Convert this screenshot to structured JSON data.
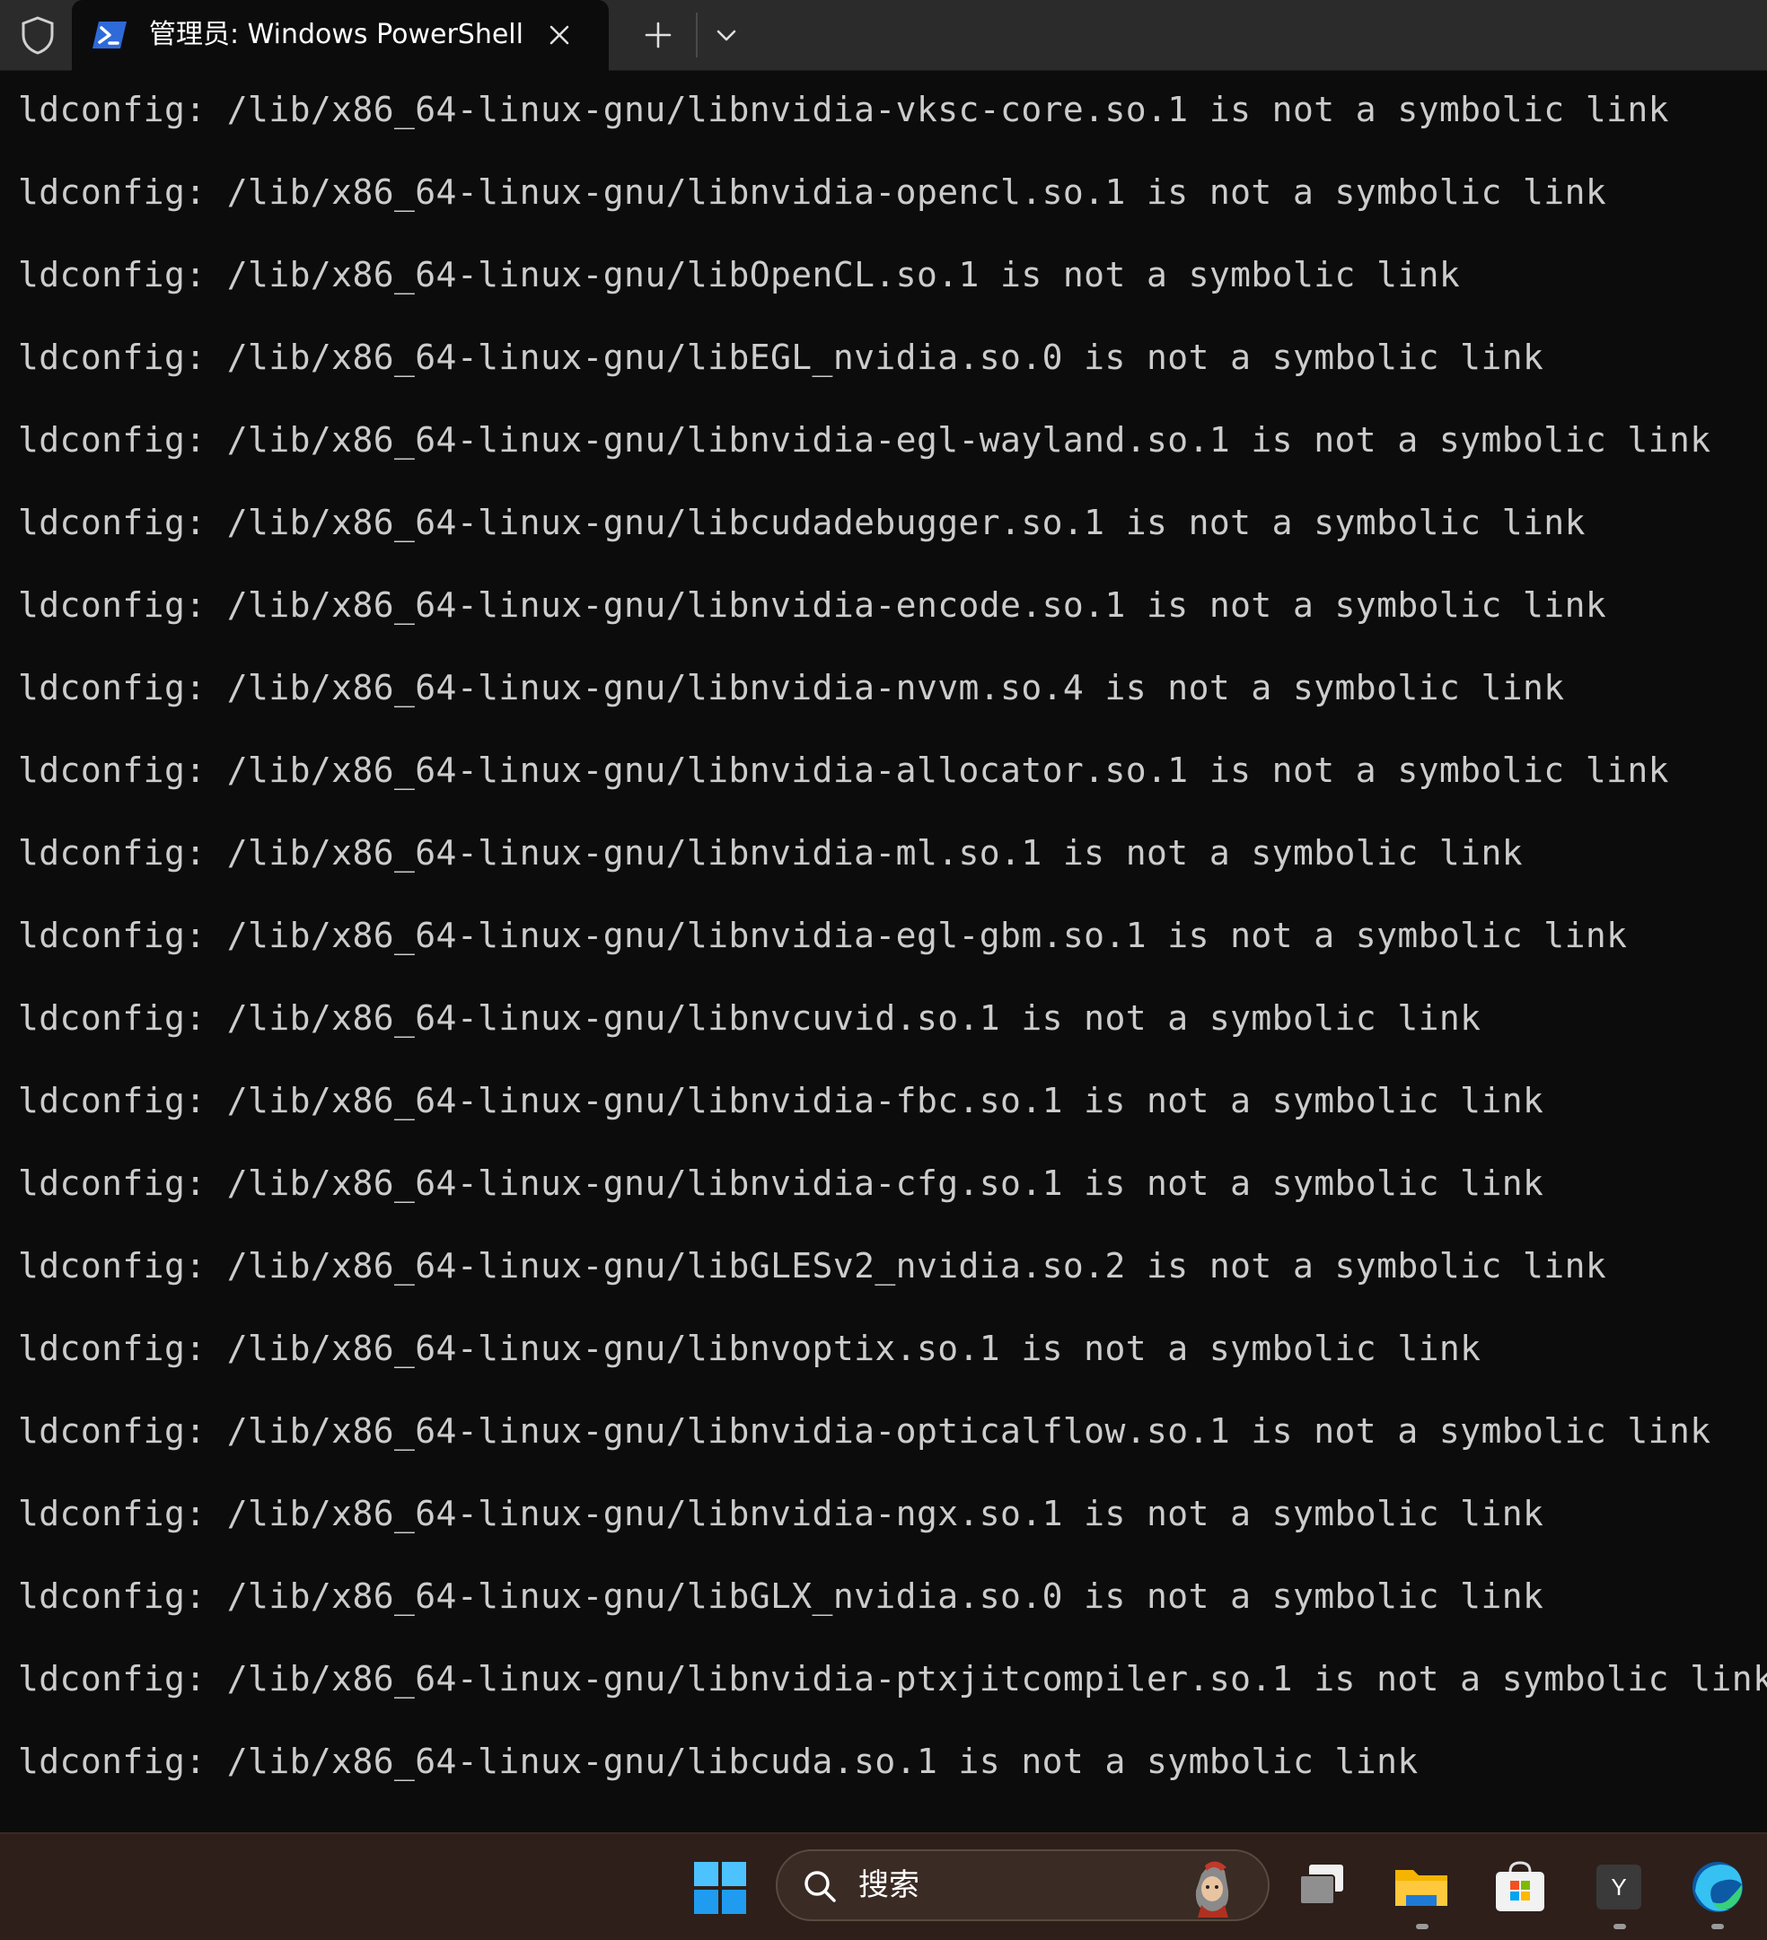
{
  "titlebar": {
    "tab_title": "管理员: Windows PowerShell",
    "icons": {
      "shield": "shield-icon",
      "powershell": "powershell-icon",
      "close": "close-icon",
      "new_tab": "plus-icon",
      "dropdown": "chevron-down-icon"
    }
  },
  "terminal": {
    "lines": [
      "ldconfig: /lib/x86_64-linux-gnu/libnvidia-vksc-core.so.1 is not a symbolic link",
      "ldconfig: /lib/x86_64-linux-gnu/libnvidia-opencl.so.1 is not a symbolic link",
      "ldconfig: /lib/x86_64-linux-gnu/libOpenCL.so.1 is not a symbolic link",
      "ldconfig: /lib/x86_64-linux-gnu/libEGL_nvidia.so.0 is not a symbolic link",
      "ldconfig: /lib/x86_64-linux-gnu/libnvidia-egl-wayland.so.1 is not a symbolic link",
      "ldconfig: /lib/x86_64-linux-gnu/libcudadebugger.so.1 is not a symbolic link",
      "ldconfig: /lib/x86_64-linux-gnu/libnvidia-encode.so.1 is not a symbolic link",
      "ldconfig: /lib/x86_64-linux-gnu/libnvidia-nvvm.so.4 is not a symbolic link",
      "ldconfig: /lib/x86_64-linux-gnu/libnvidia-allocator.so.1 is not a symbolic link",
      "ldconfig: /lib/x86_64-linux-gnu/libnvidia-ml.so.1 is not a symbolic link",
      "ldconfig: /lib/x86_64-linux-gnu/libnvidia-egl-gbm.so.1 is not a symbolic link",
      "ldconfig: /lib/x86_64-linux-gnu/libnvcuvid.so.1 is not a symbolic link",
      "ldconfig: /lib/x86_64-linux-gnu/libnvidia-fbc.so.1 is not a symbolic link",
      "ldconfig: /lib/x86_64-linux-gnu/libnvidia-cfg.so.1 is not a symbolic link",
      "ldconfig: /lib/x86_64-linux-gnu/libGLESv2_nvidia.so.2 is not a symbolic link",
      "ldconfig: /lib/x86_64-linux-gnu/libnvoptix.so.1 is not a symbolic link",
      "ldconfig: /lib/x86_64-linux-gnu/libnvidia-opticalflow.so.1 is not a symbolic link",
      "ldconfig: /lib/x86_64-linux-gnu/libnvidia-ngx.so.1 is not a symbolic link",
      "ldconfig: /lib/x86_64-linux-gnu/libGLX_nvidia.so.0 is not a symbolic link",
      "ldconfig: /lib/x86_64-linux-gnu/libnvidia-ptxjitcompiler.so.1 is not a symbolic link",
      "ldconfig: /lib/x86_64-linux-gnu/libcuda.so.1 is not a symbolic link"
    ]
  },
  "taskbar": {
    "search_placeholder": "搜索",
    "items": [
      {
        "name": "start-button",
        "icon": "windows-logo-icon"
      },
      {
        "name": "task-view-button",
        "icon": "task-view-icon"
      },
      {
        "name": "file-explorer-button",
        "icon": "folder-icon",
        "active": true
      },
      {
        "name": "microsoft-store-button",
        "icon": "store-icon"
      },
      {
        "name": "yuque-app-button",
        "icon": "y-app-icon",
        "active": true,
        "label": "Y"
      },
      {
        "name": "edge-button",
        "icon": "edge-icon",
        "active": true
      }
    ]
  },
  "colors": {
    "terminal_bg": "#0c0c0c",
    "terminal_text": "#cccccc",
    "titlebar_bg": "#2b2b2b",
    "taskbar_bg": "#2e1f1a",
    "accent_blue": "#0078d4"
  }
}
